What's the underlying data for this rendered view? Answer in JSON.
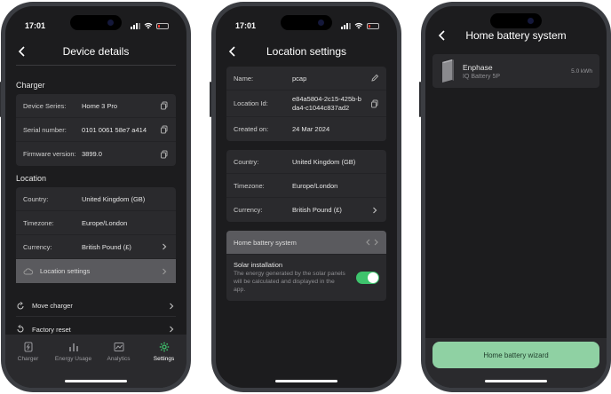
{
  "status": {
    "time": "17:01"
  },
  "screen1": {
    "title": "Device details",
    "charger_section": "Charger",
    "charger_rows": [
      {
        "label": "Device Series:",
        "value": "Home 3 Pro"
      },
      {
        "label": "Serial number:",
        "value": "0101 0061 58e7 a414"
      },
      {
        "label": "Firmware version:",
        "value": "3899.0"
      }
    ],
    "location_section": "Location",
    "location_rows": [
      {
        "label": "Country:",
        "value": "United Kingdom (GB)"
      },
      {
        "label": "Timezone:",
        "value": "Europe/London"
      },
      {
        "label": "Currency:",
        "value": "British Pound (£)"
      }
    ],
    "location_settings_label": "Location settings",
    "move_charger": "Move charger",
    "factory_reset": "Factory reset",
    "tabs": [
      {
        "label": "Charger"
      },
      {
        "label": "Energy Usage"
      },
      {
        "label": "Analytics"
      },
      {
        "label": "Settings"
      }
    ]
  },
  "screen2": {
    "title": "Location settings",
    "info_rows": [
      {
        "label": "Name:",
        "value": "pcap"
      },
      {
        "label": "Location Id:",
        "value": "e84a5804-2c15-425b-bda4-c1044c837ad2"
      },
      {
        "label": "Created on:",
        "value": "24 Mar 2024"
      }
    ],
    "region_rows": [
      {
        "label": "Country:",
        "value": "United Kingdom (GB)"
      },
      {
        "label": "Timezone:",
        "value": "Europe/London"
      },
      {
        "label": "Currency:",
        "value": "British Pound (£)"
      }
    ],
    "home_battery_label": "Home battery system",
    "solar_title": "Solar installation",
    "solar_desc": "The energy generated by the solar panels will be calculated and displayed in the app.",
    "solar_enabled": true
  },
  "screen3": {
    "title": "Home battery system",
    "battery": {
      "brand": "Enphase",
      "model": "IQ Battery 5P",
      "capacity": "5.0 kWh"
    },
    "wizard_button": "Home battery wizard"
  },
  "colors": {
    "background": "#1c1c1e",
    "card": "#2a2a2d",
    "accent_green": "#3ec46d",
    "wizard_green": "#8fd1a3"
  }
}
